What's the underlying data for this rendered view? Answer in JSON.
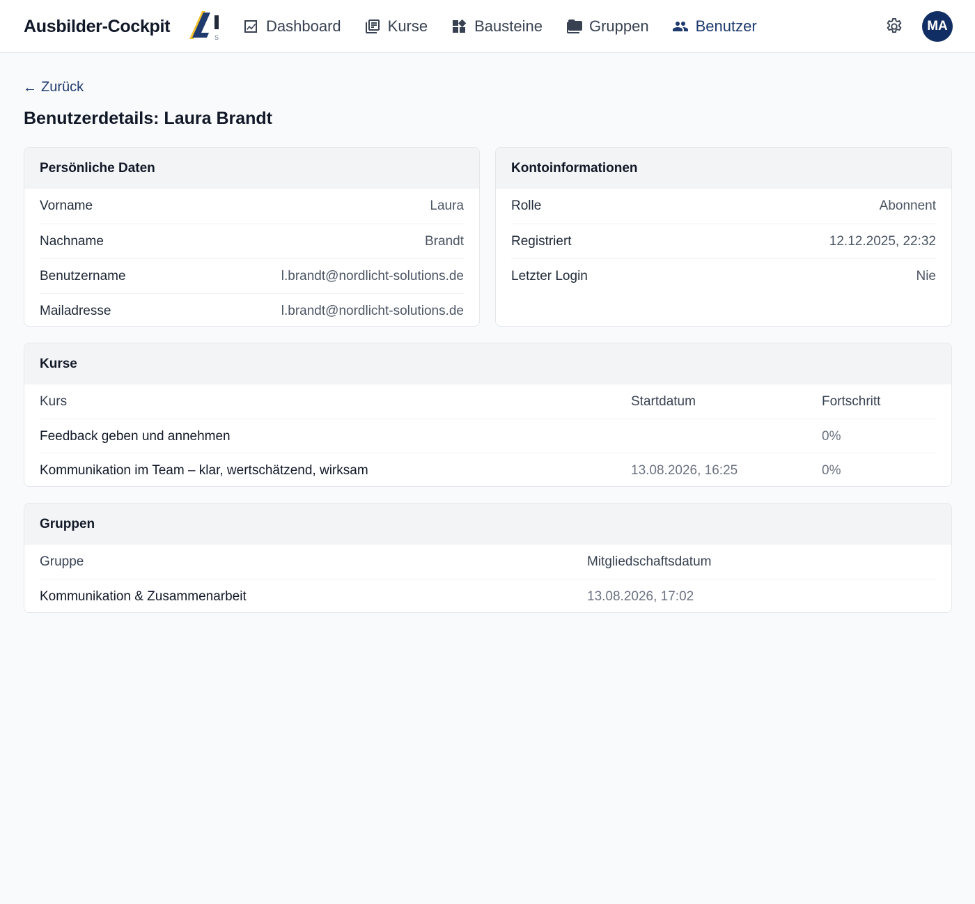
{
  "app": {
    "brand": "Ausbilder-Cockpit",
    "logo_letter": "L",
    "logo_sub": "S"
  },
  "nav": {
    "items": [
      {
        "label": "Dashboard",
        "icon": "chart-icon"
      },
      {
        "label": "Kurse",
        "icon": "book-icon"
      },
      {
        "label": "Bausteine",
        "icon": "widgets-icon"
      },
      {
        "label": "Gruppen",
        "icon": "folder-icon"
      },
      {
        "label": "Benutzer",
        "icon": "people-icon",
        "active": true
      }
    ],
    "settings_icon": "gear-icon",
    "avatar_initials": "MA"
  },
  "page": {
    "back_label": "Zurück",
    "title": "Benutzerdetails: Laura Brandt"
  },
  "personal": {
    "title": "Persönliche Daten",
    "rows": [
      {
        "label": "Vorname",
        "value": "Laura"
      },
      {
        "label": "Nachname",
        "value": "Brandt"
      },
      {
        "label": "Benutzername",
        "value": "l.brandt@nordlicht-solutions.de"
      },
      {
        "label": "Mailadresse",
        "value": "l.brandt@nordlicht-solutions.de"
      }
    ]
  },
  "account": {
    "title": "Kontoinformationen",
    "rows": [
      {
        "label": "Rolle",
        "value": "Abonnent"
      },
      {
        "label": "Registriert",
        "value": "12.12.2025, 22:32"
      },
      {
        "label": "Letzter Login",
        "value": "Nie"
      }
    ]
  },
  "courses": {
    "title": "Kurse",
    "columns": [
      "Kurs",
      "Startdatum",
      "Fortschritt"
    ],
    "rows": [
      {
        "course": "Feedback geben und annehmen",
        "start": "",
        "progress": "0%"
      },
      {
        "course": "Kommunikation im Team – klar, wertschätzend, wirksam",
        "start": "13.08.2026, 16:25",
        "progress": "0%"
      }
    ]
  },
  "groups": {
    "title": "Gruppen",
    "columns": [
      "Gruppe",
      "Mitgliedschaftsdatum"
    ],
    "rows": [
      {
        "group": "Kommunikation & Zusammenarbeit",
        "date": "13.08.2026, 17:02"
      }
    ]
  },
  "colors": {
    "accent": "#1e3a6e",
    "avatar_bg": "#102e63",
    "logo_blue": "#1e3a6e",
    "logo_yellow": "#f2c230",
    "page_bg": "#f9fafb",
    "card_header_bg": "#f3f4f6"
  }
}
